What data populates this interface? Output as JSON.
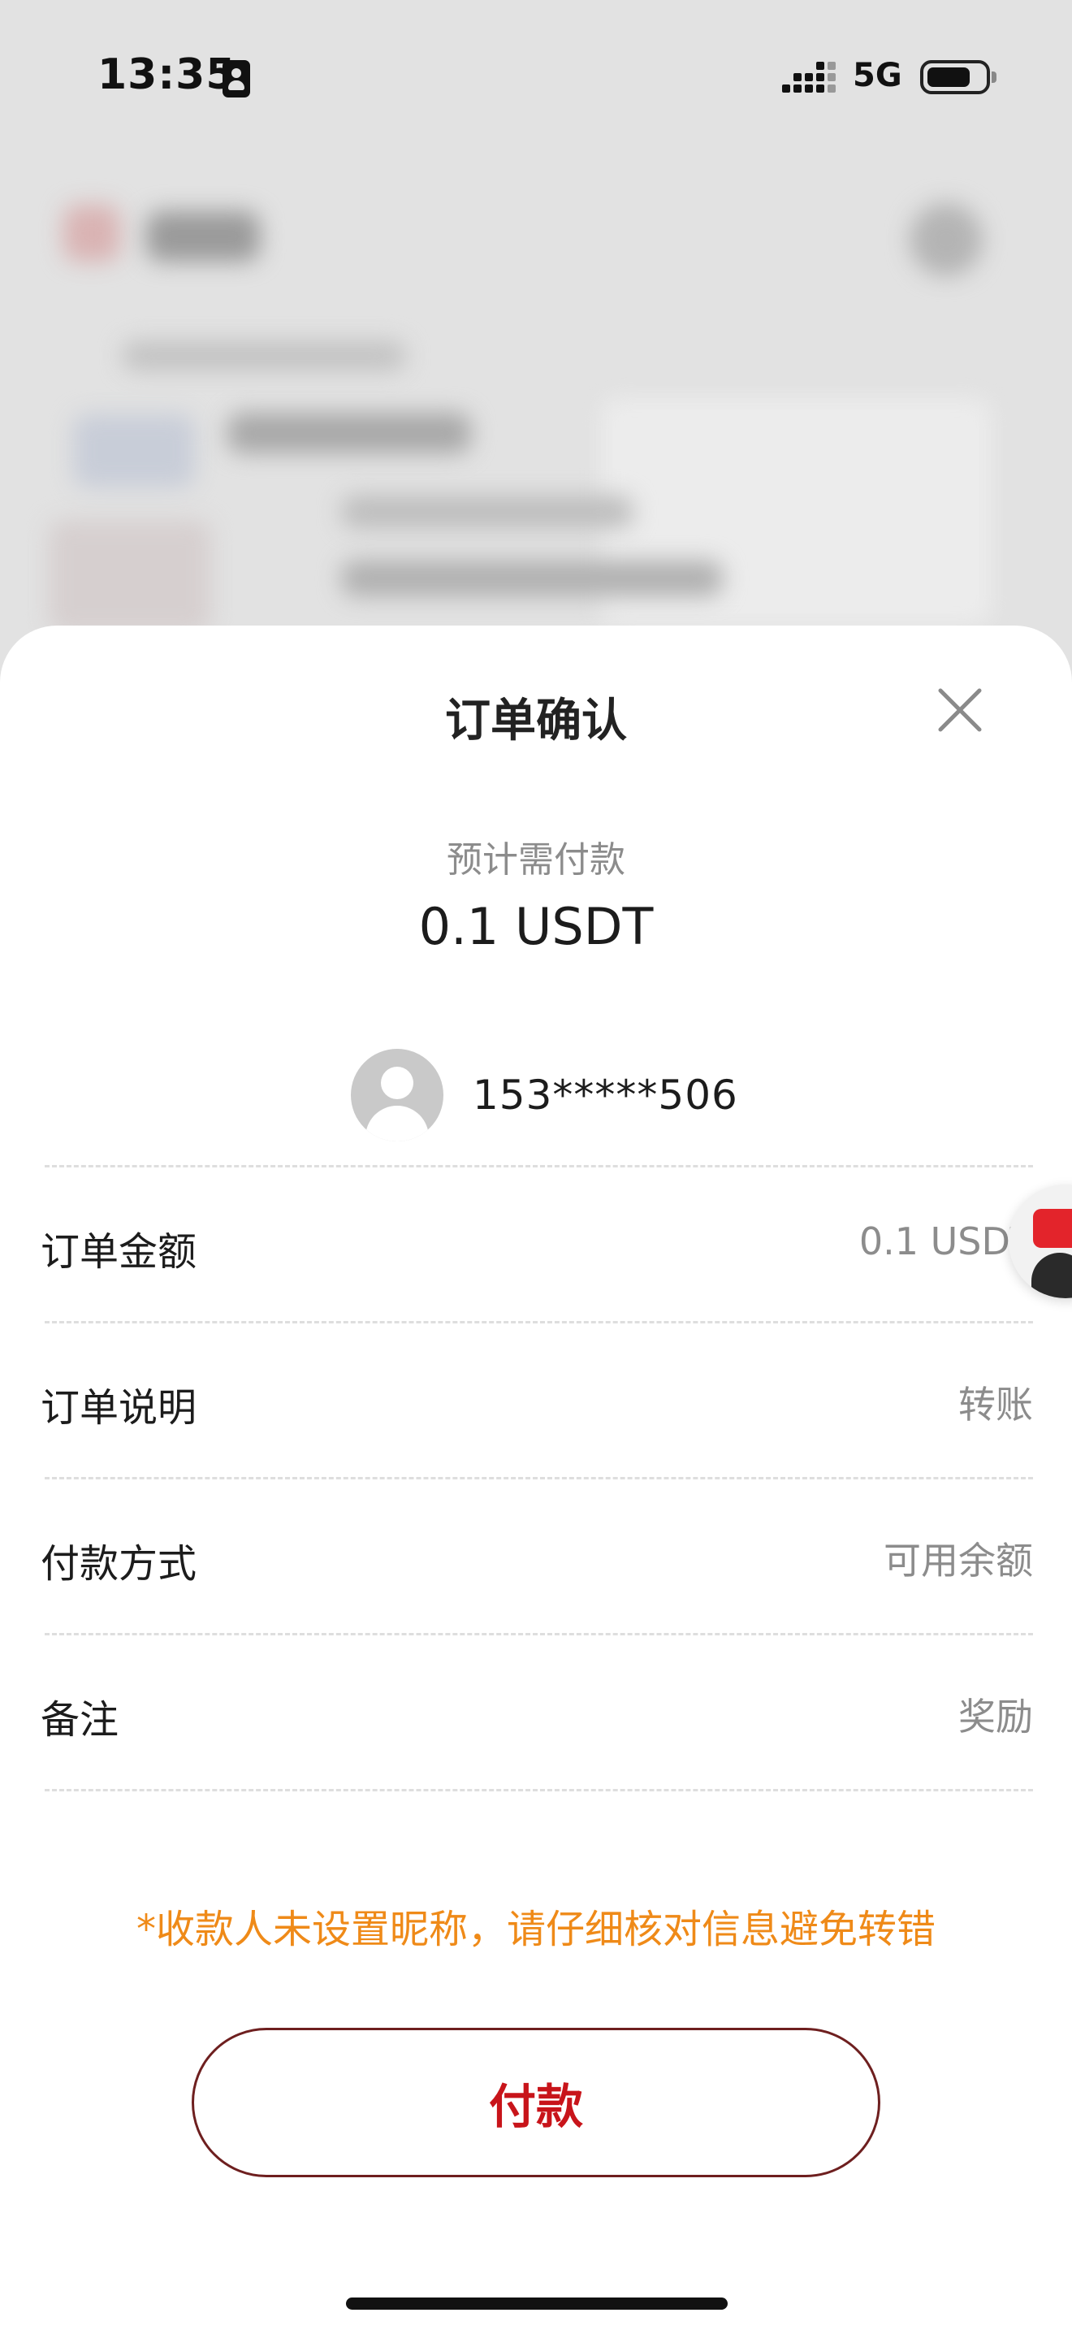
{
  "status_bar": {
    "time": "13:35",
    "network": "5G"
  },
  "sheet": {
    "title": "订单确认",
    "amount_caption": "预计需付款",
    "amount_value": "0.1 USDT",
    "payee_id": "153*****506",
    "rows": [
      {
        "label": "订单金额",
        "value": "0.1 USDT"
      },
      {
        "label": "订单说明",
        "value": "转账"
      },
      {
        "label": "付款方式",
        "value": "可用余额"
      },
      {
        "label": "备注",
        "value": "奖励"
      }
    ],
    "warning": "*收款人未设置昵称，请仔细核对信息避免转错",
    "pay_button_label": "付款"
  },
  "colors": {
    "warning": "#ef8a18",
    "pay_text": "#c8141a",
    "pay_border": "#6e1f1f"
  }
}
